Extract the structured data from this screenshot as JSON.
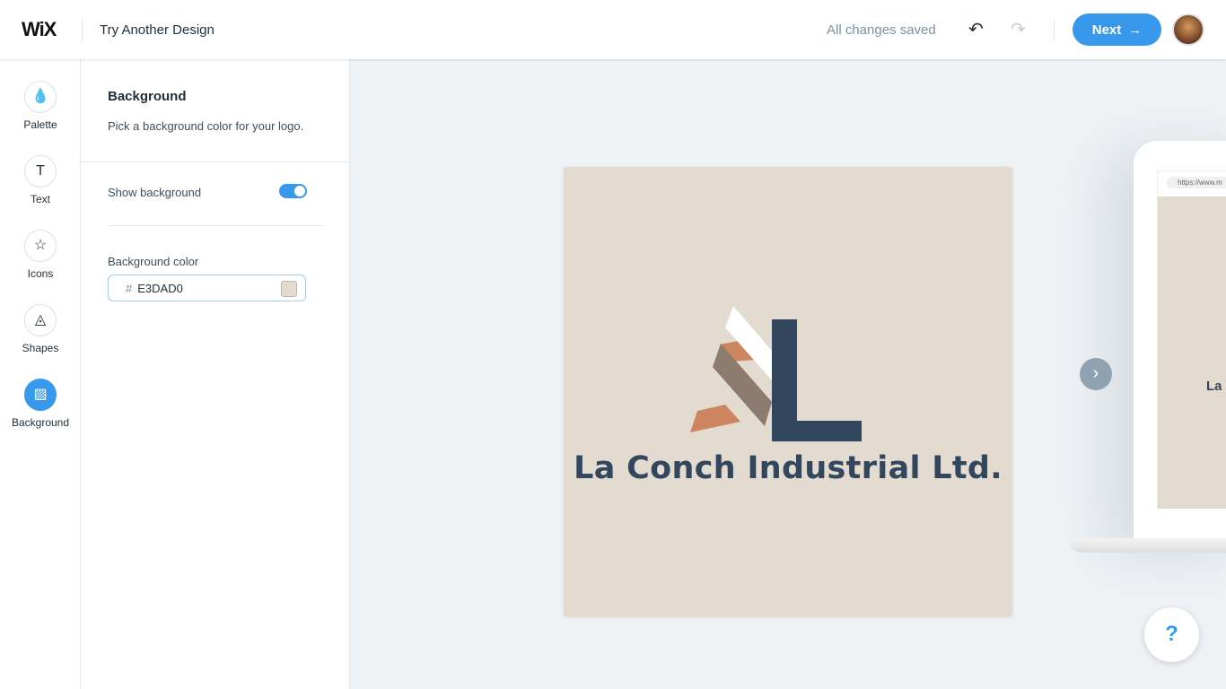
{
  "header": {
    "logo": "WiX",
    "title": "Try Another Design",
    "status": "All changes saved",
    "undo_icon": "↶",
    "redo_icon": "↷",
    "next_label": "Next",
    "next_icon": "→"
  },
  "rail": {
    "items": [
      {
        "label": "Palette",
        "icon": "💧"
      },
      {
        "label": "Text",
        "icon": "T"
      },
      {
        "label": "Icons",
        "icon": "☆"
      },
      {
        "label": "Shapes",
        "icon": "◬"
      },
      {
        "label": "Background",
        "icon": "▨"
      }
    ]
  },
  "panel": {
    "heading": "Background",
    "description": "Pick a background color for your logo.",
    "show_background_label": "Show background",
    "show_background": true,
    "color_label": "Background color",
    "hash": "#",
    "color_value": "E3DAD0"
  },
  "colors": {
    "accent": "#3899ec",
    "background": "#E3DAD0",
    "navy": "#32465e",
    "orange": "#cd8560",
    "taupe": "#8c7b6e"
  },
  "logo": {
    "brand_name": "La Conch Industrial Ltd."
  },
  "preview": {
    "url": "https://www.m",
    "brand_partial": "La",
    "arrow_icon": "›"
  },
  "help": {
    "label": "?"
  }
}
